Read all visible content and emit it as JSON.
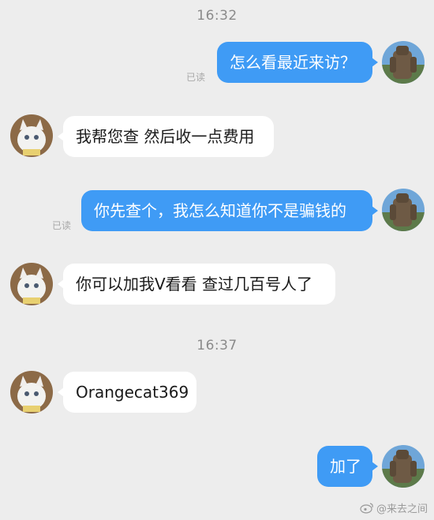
{
  "timestamps": [
    "16:32",
    "16:37"
  ],
  "messages": [
    {
      "side": "out",
      "text": "怎么看最近来访？",
      "read": "已读"
    },
    {
      "side": "in",
      "text": "我帮您查 然后收一点费用"
    },
    {
      "side": "out",
      "text": "你先查个，我怎么知道你不是骗钱的",
      "read": "已读"
    },
    {
      "side": "in",
      "text": "你可以加我V看看 查过几百号人了"
    },
    {
      "side": "in",
      "text": "Orangecat369"
    },
    {
      "side": "out",
      "text": "加了"
    }
  ],
  "watermark": "@来去之间",
  "colors": {
    "background": "#ededed",
    "outgoing_bubble": "#3f9bf5",
    "incoming_bubble": "#ffffff",
    "timestamp": "#8a8a8a"
  },
  "icons": {
    "self_avatar": "robot-statue-avatar",
    "other_avatar": "white-cat-avatar",
    "watermark": "weibo-icon"
  }
}
